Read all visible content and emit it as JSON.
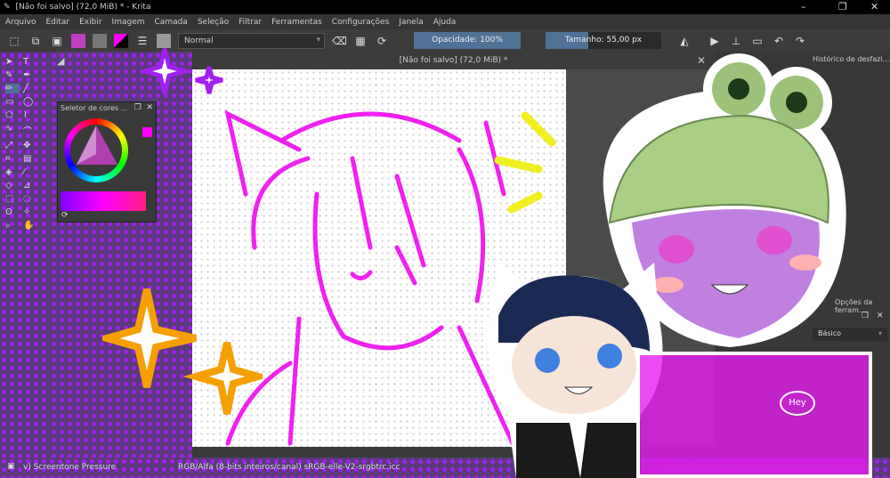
{
  "window": {
    "title": "[Não foi salvo]  (72,0 MiB) * - Krita"
  },
  "menu": [
    "Arquivo",
    "Editar",
    "Exibir",
    "Imagem",
    "Camada",
    "Seleção",
    "Filtrar",
    "Ferramentas",
    "Configurações",
    "Janela",
    "Ajuda"
  ],
  "toolbar": {
    "blend_mode": "Normal",
    "opacity": "Opacidade: 100%",
    "opacity_value": 100,
    "size": "Tamanho: 55,00 px",
    "size_fill_percent": 37
  },
  "canvas": {
    "tab_title": "[Não foi salvo]  (72,0 MiB) *"
  },
  "docker": {
    "color_selector_title": "Seletor de cores ..."
  },
  "right_panel": {
    "undo_history": "Histórico de desfazi...",
    "tool_options": "Opções da ferram...",
    "preset": "Básico"
  },
  "status": {
    "brush": "v) Screentone Pressure",
    "color_space": "RGB/Alfa (8-bits inteiros/canal)  sRGB-elle-V2-srgbtrc.icc"
  },
  "sticker": {
    "speech": "Hey"
  },
  "colors": {
    "accent": "#4f7196",
    "magenta": "#ff00ff",
    "purple_dots": "#a020f0"
  }
}
